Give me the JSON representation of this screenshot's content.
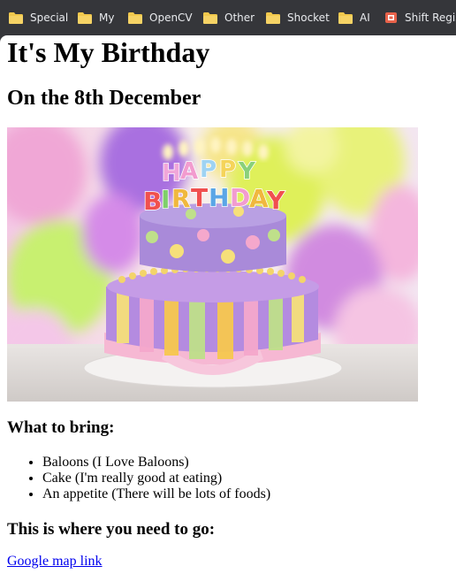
{
  "bookmarks": [
    {
      "label": "Special",
      "icon": "folder-icon"
    },
    {
      "label": "My",
      "icon": "folder-icon"
    },
    {
      "label": "OpenCV",
      "icon": "folder-icon"
    },
    {
      "label": "Other",
      "icon": "folder-icon"
    },
    {
      "label": "Shocket",
      "icon": "folder-icon"
    },
    {
      "label": "AI",
      "icon": "folder-icon"
    },
    {
      "label": "Shift Regist",
      "icon": "shift-register-icon"
    }
  ],
  "page": {
    "title": "It's My Birthday",
    "subtitle": "On the 8th December",
    "image_text": "HAPPY BIRTHDAY",
    "bring_heading": "What to bring:",
    "bring_items": [
      "Baloons (I Love Baloons)",
      "Cake (I'm really good at eating)",
      "An appetite (There will be lots of foods)"
    ],
    "go_heading": "This is where you need to go:",
    "map_link": "Google map link"
  },
  "colors": {
    "bookmarks_bg": "#35363a",
    "bookmark_text": "#e8eaed",
    "folder": "#f2c94c",
    "link": "#0000ee"
  }
}
